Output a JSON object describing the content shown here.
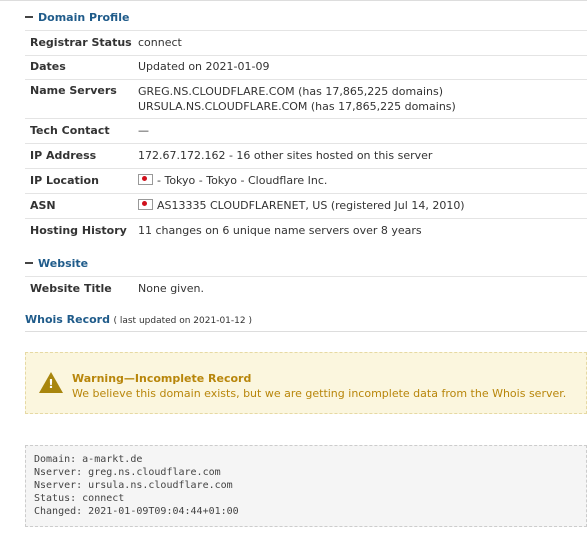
{
  "domain_profile": {
    "heading": "Domain Profile",
    "rows": [
      {
        "label": "Registrar Status",
        "values": [
          "connect"
        ]
      },
      {
        "label": "Dates",
        "values": [
          "Updated on 2021-01-09"
        ]
      },
      {
        "label": "Name Servers",
        "values": [
          "GREG.NS.CLOUDFLARE.COM (has 17,865,225 domains)",
          "URSULA.NS.CLOUDFLARE.COM (has 17,865,225 domains)"
        ]
      },
      {
        "label": "Tech Contact",
        "values": [
          "—"
        ]
      },
      {
        "label": "IP Address",
        "values": [
          "172.67.172.162 - 16 other sites hosted on this server"
        ]
      },
      {
        "label": "IP Location",
        "values": [
          "- Tokyo - Tokyo - Cloudflare Inc."
        ],
        "flag": "japan-flag-icon"
      },
      {
        "label": "ASN",
        "values": [
          "AS13335 CLOUDFLARENET, US (registered Jul 14, 2010)"
        ],
        "flag": "japan-flag-icon"
      },
      {
        "label": "Hosting History",
        "values": [
          "11 changes on 6 unique name servers over 8 years"
        ]
      }
    ]
  },
  "website": {
    "heading": "Website",
    "rows": [
      {
        "label": "Website Title",
        "values": [
          "None given."
        ]
      }
    ]
  },
  "whois": {
    "title": "Whois Record",
    "updated": "( last updated on 2021-01-12 )",
    "warning_title": "Warning—Incomplete Record",
    "warning_message": "We believe this domain exists, but we are getting incomplete data from the Whois server.",
    "raw_lines": [
      "Domain: a-markt.de",
      "Nserver: greg.ns.cloudflare.com",
      "Nserver: ursula.ns.cloudflare.com",
      "Status: connect",
      "Changed: 2021-01-09T09:04:44+01:00"
    ]
  },
  "colors": {
    "accent": "#1f5b8a",
    "warning_text": "#b8860b",
    "warning_bg": "#fbf6de"
  }
}
